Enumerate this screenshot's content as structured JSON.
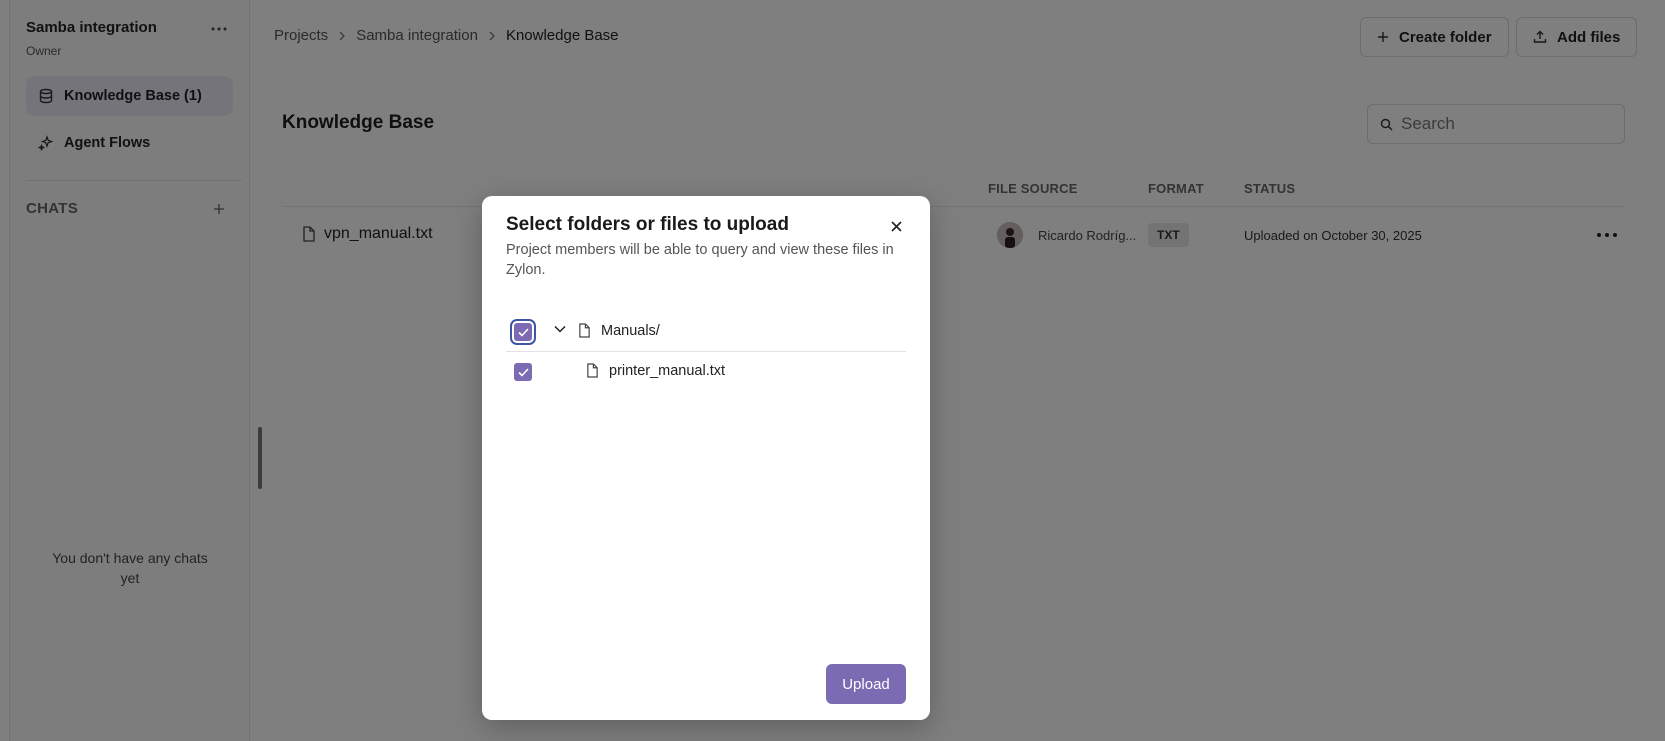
{
  "sidebar": {
    "project_title": "Samba integration",
    "project_role": "Owner",
    "items": [
      {
        "label": "Knowledge Base (1)",
        "icon": "database-icon",
        "active": true
      },
      {
        "label": "Agent Flows",
        "icon": "sparkles-icon",
        "active": false
      }
    ],
    "chats_label": "CHATS",
    "empty_chats": "You don't have any chats yet"
  },
  "header": {
    "breadcrumb": [
      "Projects",
      "Samba integration",
      "Knowledge Base"
    ],
    "create_folder_label": "Create folder",
    "add_files_label": "Add files"
  },
  "main": {
    "title": "Knowledge Base",
    "search_placeholder": "Search",
    "columns": {
      "file_source": "FILE SOURCE",
      "format": "FORMAT",
      "status": "STATUS"
    },
    "rows": [
      {
        "name": "vpn_manual.txt",
        "owner": "Ricardo Rodríg...",
        "format": "TXT",
        "status": "Uploaded on October 30, 2025"
      }
    ]
  },
  "modal": {
    "title": "Select folders or files to upload",
    "description": "Project members will be able to query and view these files in Zylon.",
    "tree": [
      {
        "type": "folder",
        "label": "Manuals/",
        "checked": true,
        "expanded": true
      },
      {
        "type": "file",
        "label": "printer_manual.txt",
        "checked": true
      }
    ],
    "upload_label": "Upload"
  },
  "colors": {
    "accent": "#7b6bb3",
    "active_bg": "#ebe8f6",
    "overlay": "rgba(0,0,0,0.5)"
  }
}
